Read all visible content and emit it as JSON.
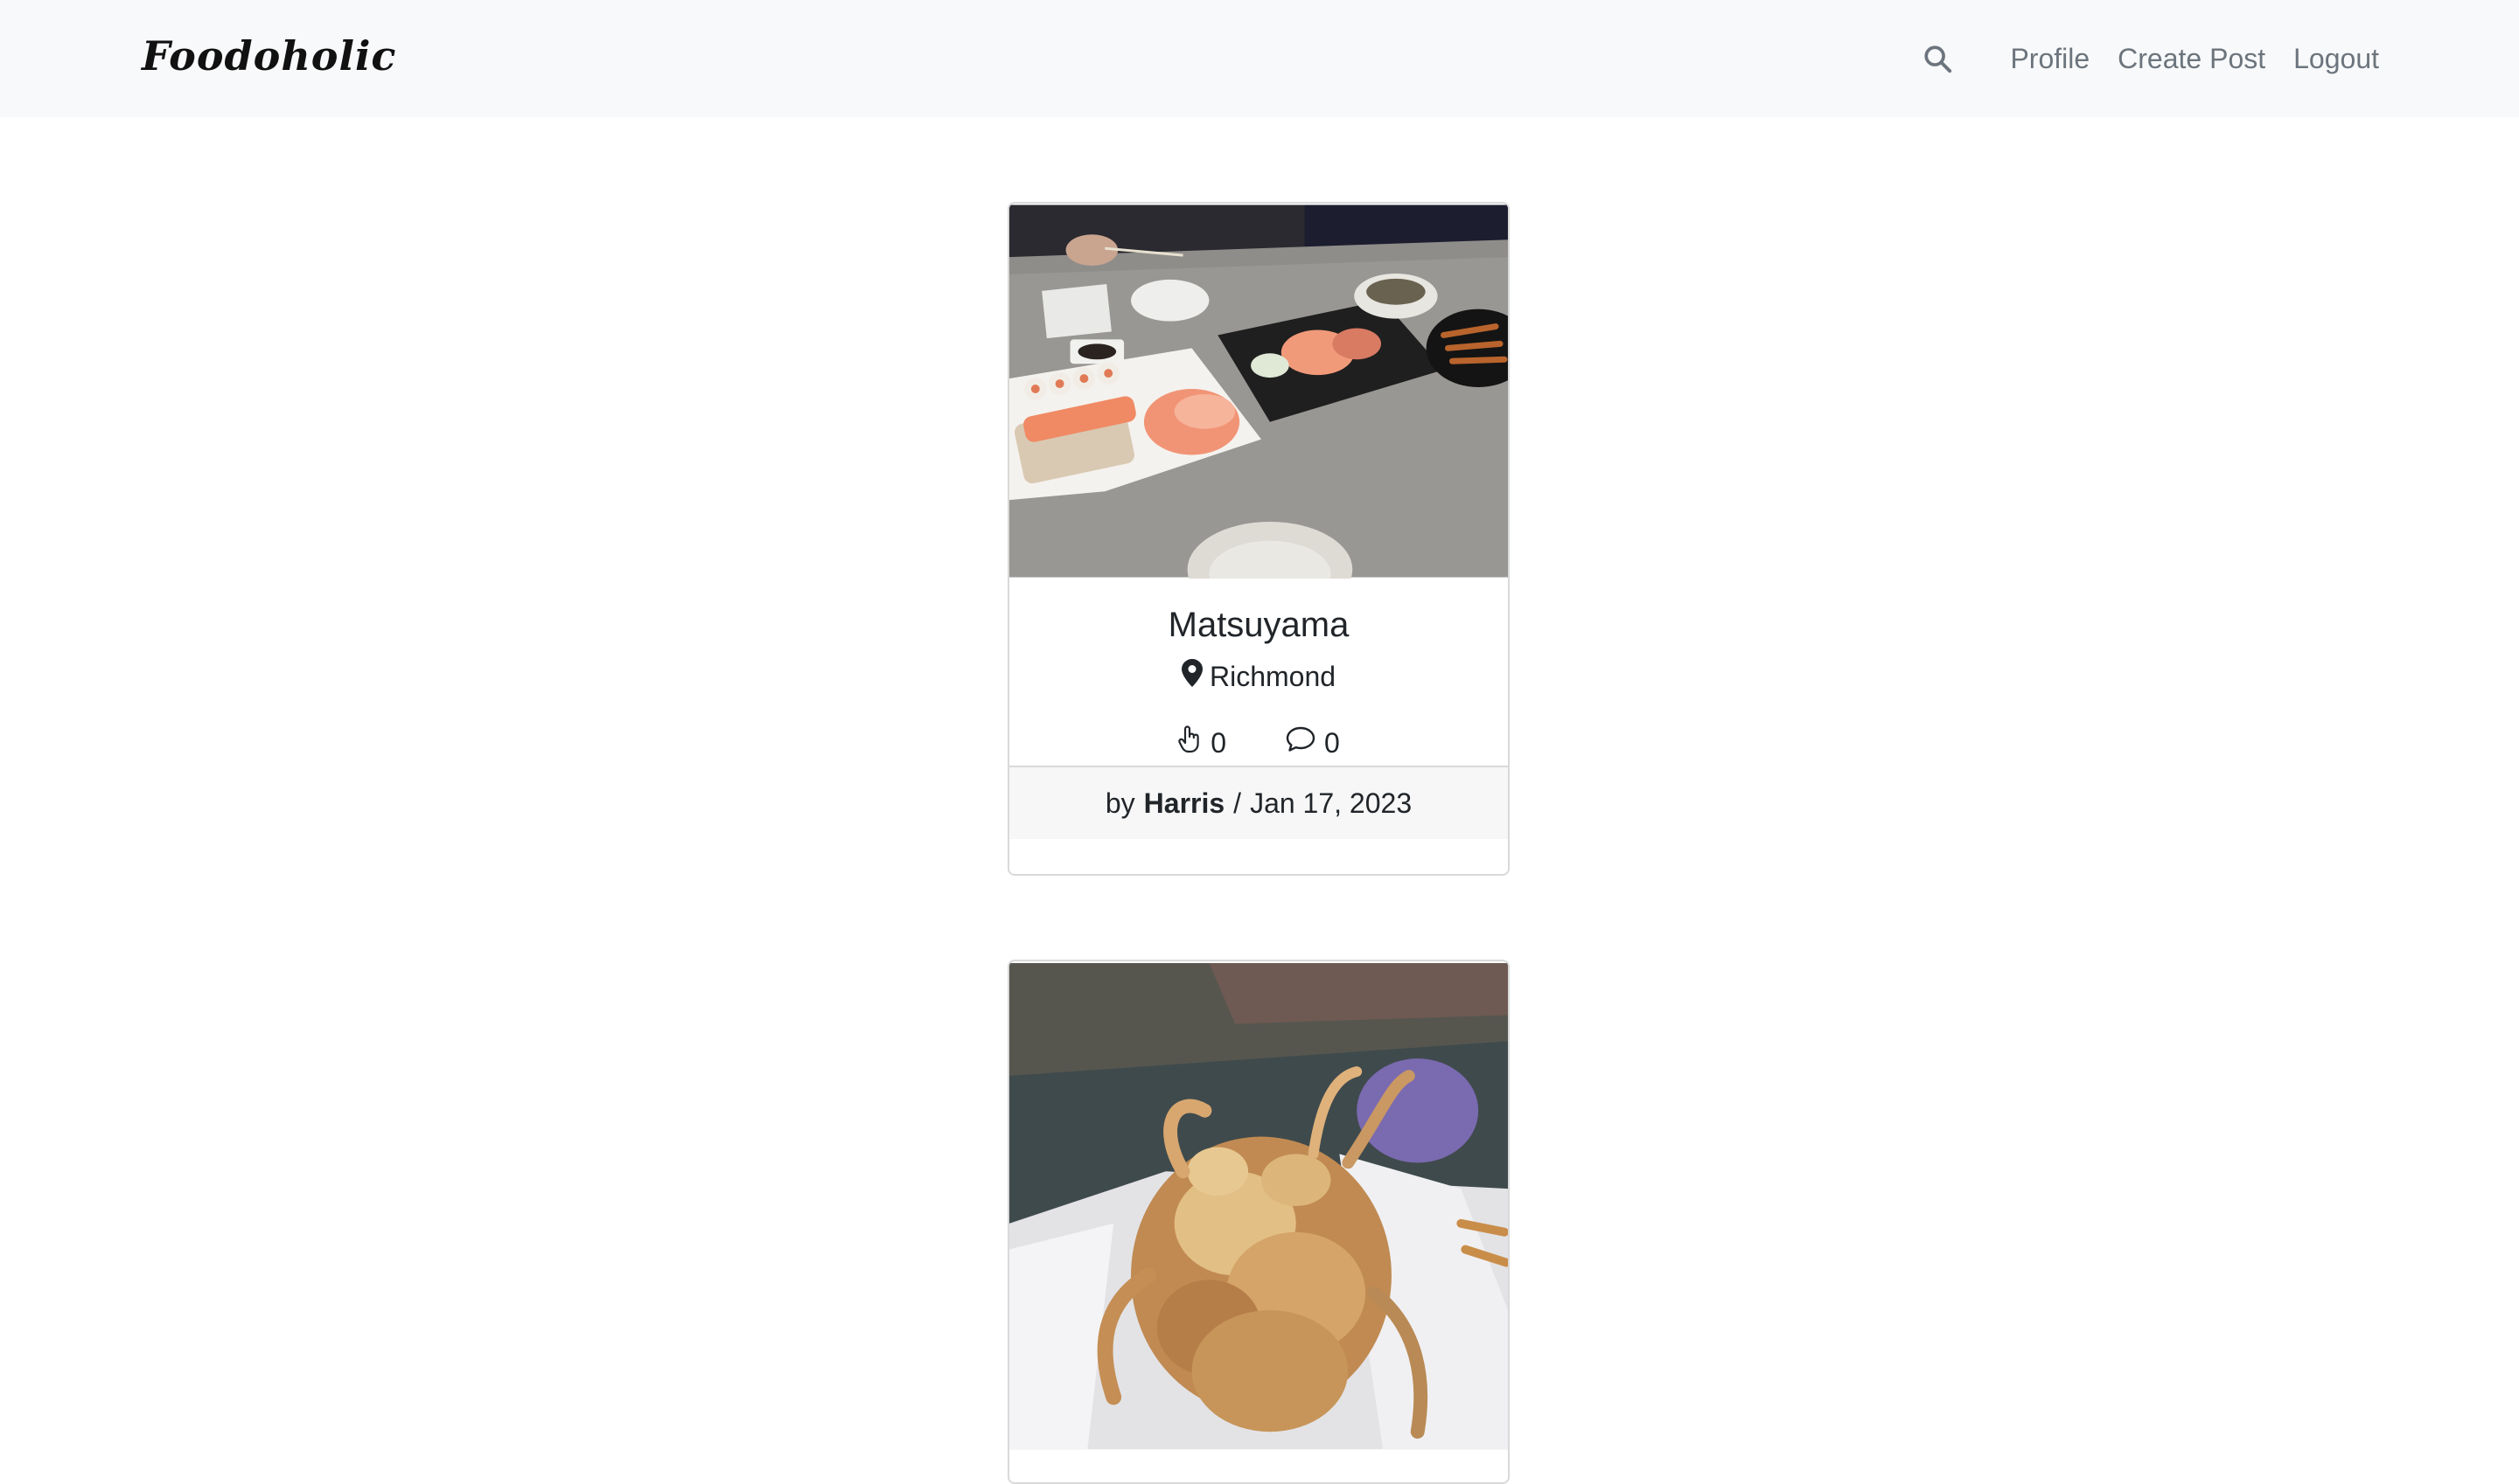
{
  "brand": "Foodoholic",
  "nav": {
    "search_icon": "search-icon",
    "links": [
      "Profile",
      "Create Post",
      "Logout"
    ]
  },
  "posts": [
    {
      "title": "Matsuyama",
      "location": "Richmond",
      "likes": "0",
      "comments": "0",
      "by_label": "by",
      "author": "Harris",
      "date_sep": "/",
      "date": "Jan 17, 2023",
      "image_desc": "sushi-platter-photo"
    },
    {
      "image_desc": "fried-squid-photo"
    }
  ],
  "colors": {
    "navbar_bg": "#f8f9fa",
    "nav_link": "#6c757d",
    "footer_bg": "#f7f7f7"
  }
}
